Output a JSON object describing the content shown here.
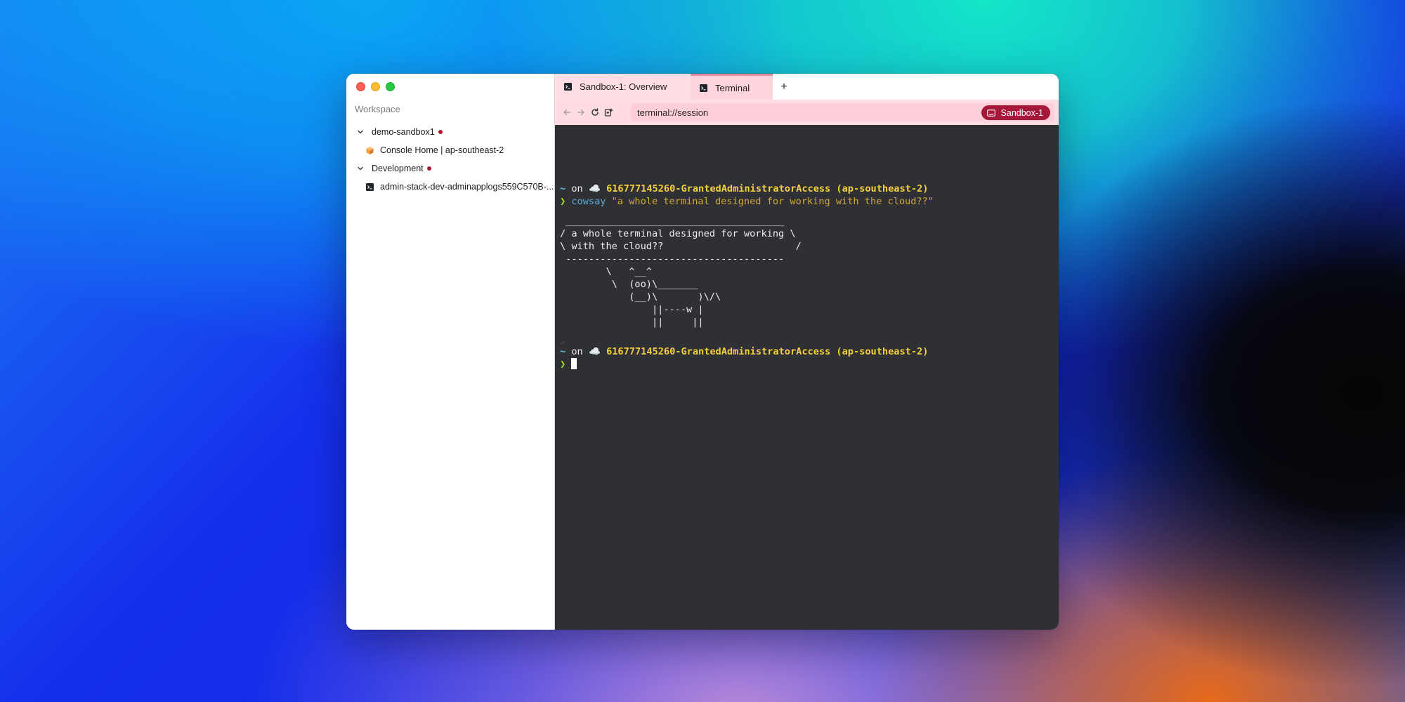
{
  "sidebar": {
    "workspace_label": "Workspace",
    "groups": [
      {
        "label": "demo-sandbox1",
        "child_label": "Console Home | ap-southeast-2",
        "child_icon": "aws-console-icon"
      },
      {
        "label": "Development",
        "child_label": "admin-stack-dev-adminapplogs559C570B-...",
        "child_icon": "terminal-icon"
      }
    ],
    "status_dot_color": "#b0172f"
  },
  "tabs": [
    {
      "label": "Sandbox-1: Overview",
      "icon": "terminal-icon"
    },
    {
      "label": "Terminal",
      "icon": "terminal-icon"
    }
  ],
  "new_tab_label": "+",
  "address_bar": {
    "url": "terminal://session",
    "profile_badge": "Sandbox-1",
    "badge_color": "#a5183a"
  },
  "terminal": {
    "prompt1": {
      "tilde": "~",
      "on": " on ",
      "cloud": "☁️",
      "context": "616777145260-GrantedAdministratorAccess (ap-southeast-2)"
    },
    "command_line": {
      "arrow": "❯",
      "command": "cowsay",
      "argument": "\"a whole terminal designed for working with the cloud??\""
    },
    "cowsay_output": " ______________________________________\n/ a whole terminal designed for working \\\n\\ with the cloud??                       /\n --------------------------------------\n        \\   ^__^\n         \\  (oo)\\_______\n            (__)\\       )\\/\\\n                ||----w |\n                ||     ||",
    "return_glyph": "⏎",
    "prompt2": {
      "tilde": "~",
      "on": " on ",
      "cloud": "☁️",
      "context": "616777145260-GrantedAdministratorAccess (ap-southeast-2)"
    },
    "input_arrow": "❯"
  },
  "colors": {
    "terminal_bg": "#2f3033",
    "prompt_context": "#f4d03f",
    "command": "#5ea9d6",
    "string": "#d4a83a",
    "arrow": "#a6d93a"
  }
}
